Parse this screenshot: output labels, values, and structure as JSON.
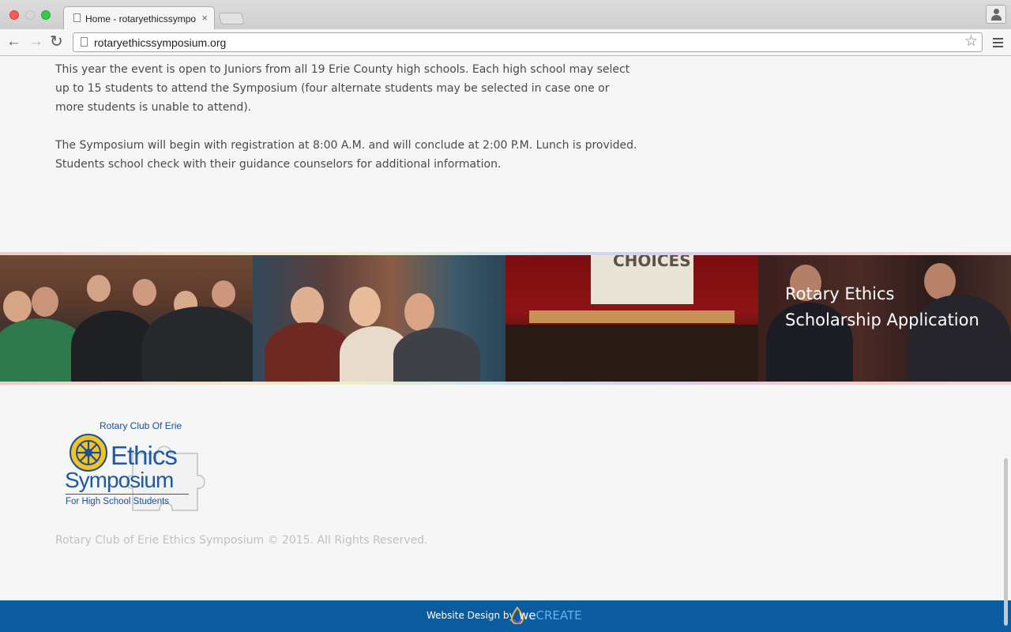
{
  "browser": {
    "tab_title": "Home - rotaryethicssympo",
    "tab_close": "×",
    "url": "rotaryethicssymposium.org",
    "back_glyph": "←",
    "forward_glyph": "→",
    "reload_glyph": "↻",
    "star_glyph": "☆",
    "icons": [
      "page-icon",
      "back-icon",
      "forward-icon",
      "reload-icon",
      "star-icon",
      "menu-icon",
      "profile-icon"
    ]
  },
  "content": {
    "paragraphs": [
      "This year the event is open to Juniors from all 19 Erie County high schools. Each high school may select up to 15 students to attend the Symposium (four alternate students may be selected in case one or more students is unable to attend).",
      "The Symposium will begin with registration at 8:00 A.M. and will conclude at 2:00 P.M. Lunch is provided. Students school check with their guidance counselors for additional information."
    ]
  },
  "banner": {
    "screen_text": "CHOICES",
    "caption_line1": "Rotary Ethics",
    "caption_line2": "Scholarship Application"
  },
  "footer": {
    "logo_top": "Rotary Club Of Erie",
    "logo_ethics": "Ethics",
    "logo_symposium": "Symposium",
    "logo_sub": "For High School Students",
    "copyright": "Rotary Club of Erie Ethics Symposium © 2015. All Rights Reserved.",
    "credit": "Website Design by",
    "brand_we": "we",
    "brand_create": "CREATE"
  },
  "colors": {
    "footer_bar": "#0a5c9e",
    "logo_blue": "#1a5aa8",
    "body_text": "#4a4a4a",
    "copyright_text": "#c0c0c0"
  }
}
